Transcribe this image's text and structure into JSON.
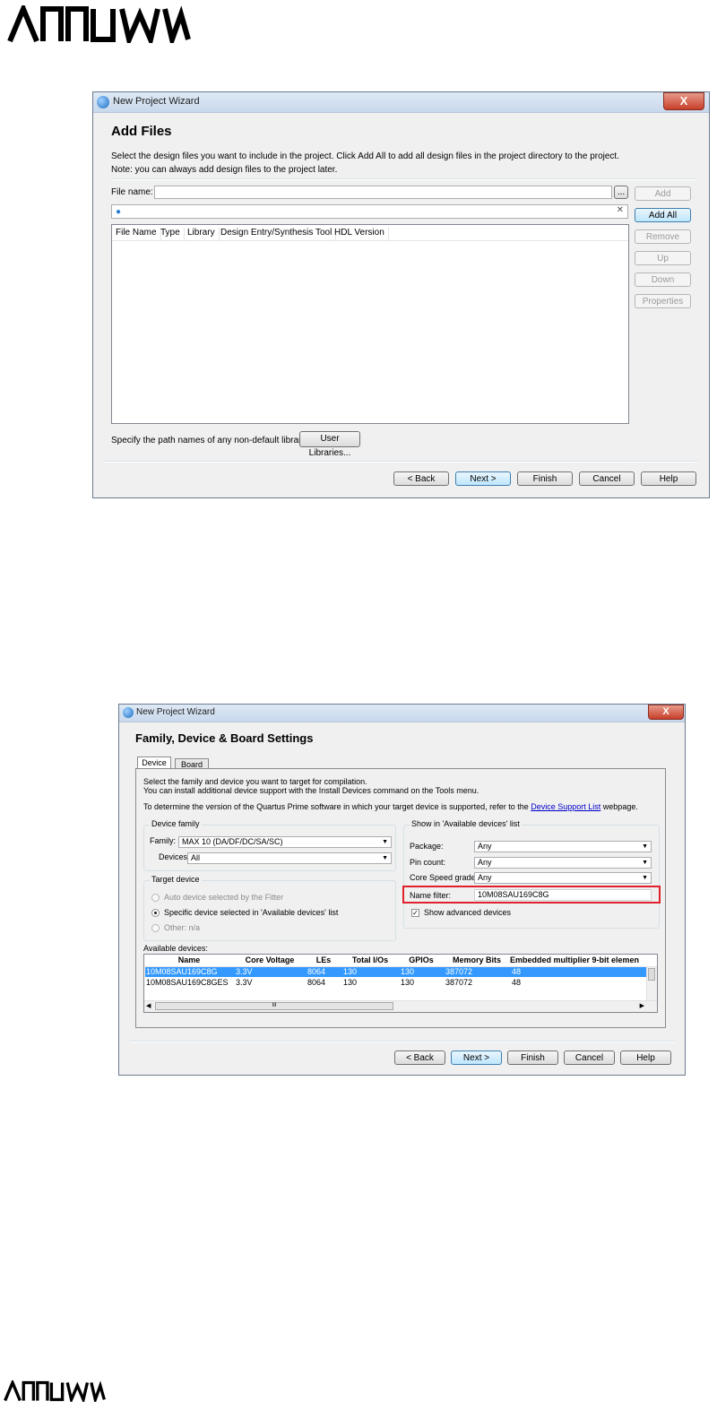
{
  "logo_text": "ARROW",
  "wizard1": {
    "window_title": "New Project Wizard",
    "close_label": "X",
    "heading": "Add Files",
    "desc_line1": "Select the design files you want to include in the project. Click Add All to add all design files in the project directory to the project.",
    "desc_line2": "Note: you can always add design files to the project later.",
    "file_name_label": "File name:",
    "browse_label": "...",
    "search_clear": "✕",
    "columns": [
      "File Name",
      "Type",
      "Library",
      "Design Entry/Synthesis Tool",
      "HDL Version"
    ],
    "side_buttons": [
      "Add",
      "Add All",
      "Remove",
      "Up",
      "Down",
      "Properties"
    ],
    "libraries_label": "Specify the path names of any non-default libraries.",
    "user_libraries_button": "User Libraries...",
    "footer_buttons": [
      "< Back",
      "Next >",
      "Finish",
      "Cancel",
      "Help"
    ]
  },
  "wizard2": {
    "window_title": "New Project Wizard",
    "close_label": "X",
    "heading": "Family, Device & Board Settings",
    "tabs": [
      "Device",
      "Board"
    ],
    "intro_line1": "Select the family and device you want to target for compilation.",
    "intro_line2": "You can install additional device support with the Install Devices command on the Tools menu.",
    "version_text": "To determine the version of the Quartus Prime software in which your target device is supported, refer to the",
    "version_link": "Device Support List",
    "version_suffix": "webpage.",
    "device_family": {
      "group_label": "Device family",
      "family_label": "Family:",
      "family_value": "MAX 10 (DA/DF/DC/SA/SC)",
      "devices_label": "Devices:",
      "devices_value": "All"
    },
    "target_device": {
      "group_label": "Target device",
      "options": [
        "Auto device selected by the Fitter",
        "Specific device selected in 'Available devices' list",
        "Other:  n/a"
      ],
      "selected_index": 1
    },
    "show_in_list": {
      "group_label": "Show in 'Available devices' list",
      "package_label": "Package:",
      "package_value": "Any",
      "pin_count_label": "Pin count:",
      "pin_count_value": "Any",
      "speed_label": "Core Speed grade:",
      "speed_value": "Any",
      "name_filter_label": "Name filter:",
      "name_filter_value": "10M08SAU169C8G",
      "show_advanced_label": "Show advanced devices",
      "show_advanced_checked": true,
      "highlight_color": "#e0202a"
    },
    "available_label": "Available devices:",
    "columns": [
      "Name",
      "Core Voltage",
      "LEs",
      "Total I/Os",
      "GPIOs",
      "Memory Bits",
      "Embedded multiplier 9-bit elemen"
    ],
    "rows": [
      [
        "10M08SAU169C8G",
        "3.3V",
        "8064",
        "130",
        "130",
        "387072",
        "48"
      ],
      [
        "10M08SAU169C8GES",
        "3.3V",
        "8064",
        "130",
        "130",
        "387072",
        "48"
      ]
    ],
    "selected_row": 0,
    "scroll_thumb": "III",
    "footer_buttons": [
      "< Back",
      "Next >",
      "Finish",
      "Cancel",
      "Help"
    ]
  }
}
